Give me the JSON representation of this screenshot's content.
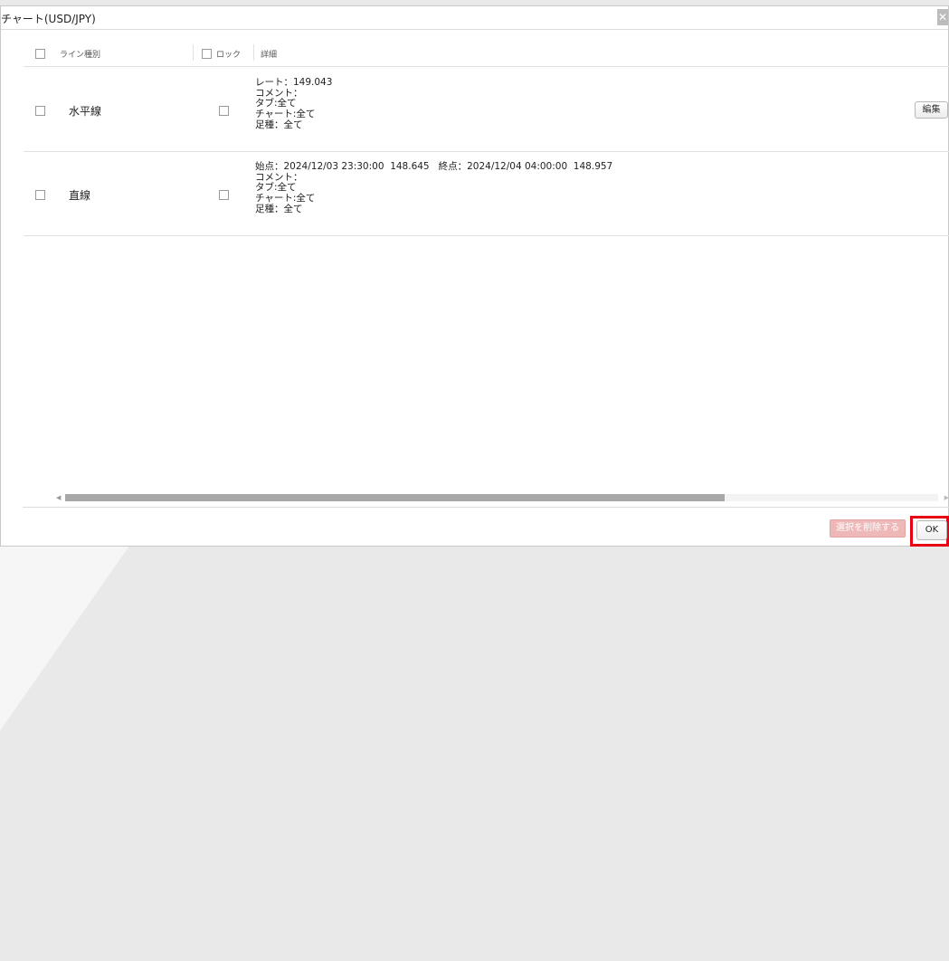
{
  "window": {
    "title": "チャート(USD/JPY)",
    "close_icon": "close-icon",
    "close_glyph": "✕"
  },
  "table": {
    "headers": {
      "type": "ライン種別",
      "lock": "ロック",
      "details": "詳細"
    },
    "rows": [
      {
        "type": "水平線",
        "details": "レート：149.043\nコメント：\nタブ:全て\nチャート:全て\n足種：全て",
        "edit_label": "編集"
      },
      {
        "type": "直線",
        "details": "始点：2024/12/03 23:30:00  148.645   終点：2024/12/04 04:00:00  148.957\nコメント：\nタブ:全て\nチャート:全て\n足種：全て"
      }
    ]
  },
  "scrollbar": {
    "left_arrow": "◀",
    "right_arrow": "▶",
    "position_fraction": 0.0,
    "visible_fraction": 0.755
  },
  "footer": {
    "delete_label": "選択を削除する",
    "ok_label": "OK"
  },
  "colors": {
    "highlight": "#e60012",
    "delete_button_disabled": "#eeb8b8"
  }
}
